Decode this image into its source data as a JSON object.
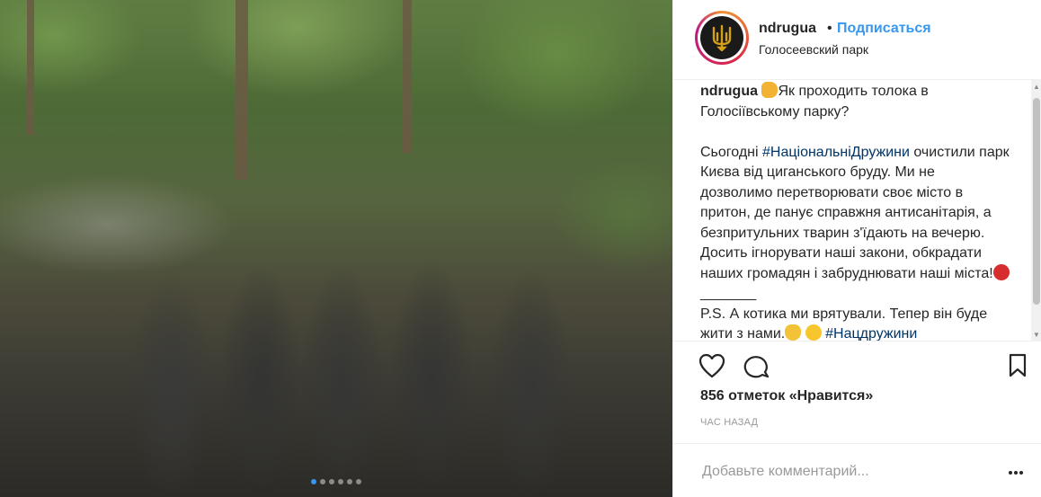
{
  "post": {
    "username": "ndrugua",
    "bullet": "•",
    "follow_label": "Подписаться",
    "location": "Голосеевский парк"
  },
  "media": {
    "carousel_total": 6,
    "carousel_active": 1
  },
  "caption": {
    "username": "ndrugua",
    "line1_text": "Як проходить толока в Голосіївському парку?",
    "p2_before": "Сьогодні ",
    "p2_tag": "#НаціональніДружини",
    "p2_after": " очистили парк Києва від циганського бруду. Ми не дозволимо перетворювати своє місто в притон, де панує справжня антисанітарія, а безпритульних тварин з'їдають на вечерю. Досить ігнорувати наші закони, обкрадати наших громадян і забруднювати наші міста!",
    "p2_tail": " _______",
    "p3_text": "P.S. А котика ми врятували. Тепер він буде жити з нами.",
    "p3_tag": "#Нацдружини"
  },
  "stats": {
    "likes": "856 отметок «Нравится»",
    "time": "ЧАС НАЗАД"
  },
  "comment": {
    "placeholder": "Добавьте комментарий..."
  },
  "icons": {
    "like": "heart-icon",
    "comment": "comment-icon",
    "save": "bookmark-icon",
    "options": "more-options-icon",
    "emoji_fist": "fist-emoji",
    "emoji_angry": "angry-face-emoji",
    "emoji_cat": "cat-face-emoji",
    "emoji_smile": "smiling-face-emoji"
  },
  "colors": {
    "link": "#3897f0",
    "hashtag": "#003569",
    "text": "#262626",
    "muted": "#999999",
    "divider": "#efefef"
  }
}
